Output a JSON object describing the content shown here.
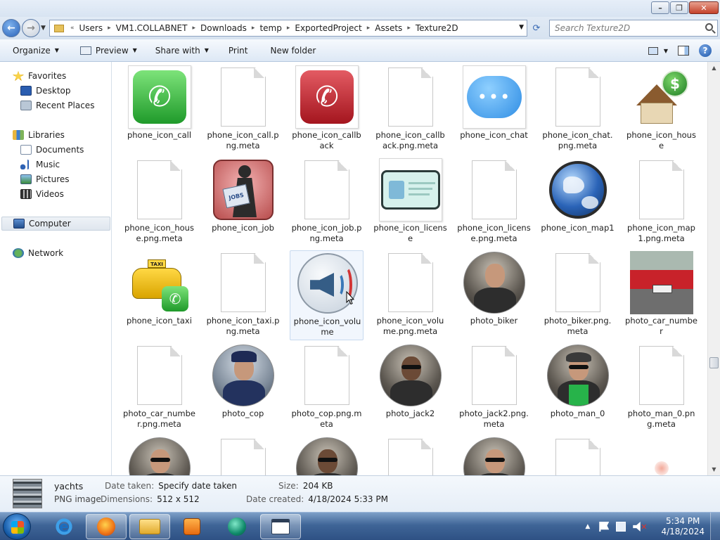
{
  "window": {
    "buttons": {
      "minimize": "–",
      "maximize": "❐",
      "close": "✕"
    }
  },
  "address": {
    "prefix": "«",
    "crumbs": [
      "Users",
      "VM1.COLLABNET",
      "Downloads",
      "temp",
      "ExportedProject",
      "Assets",
      "Texture2D"
    ],
    "search_placeholder": "Search Texture2D"
  },
  "toolbar": {
    "organize": "Organize",
    "preview": "Preview",
    "share_with": "Share with",
    "print": "Print",
    "new_folder": "New folder",
    "help": "?"
  },
  "nav": {
    "favorites": "Favorites",
    "desktop": "Desktop",
    "recent_places": "Recent Places",
    "libraries": "Libraries",
    "documents": "Documents",
    "music": "Music",
    "pictures": "Pictures",
    "videos": "Videos",
    "computer": "Computer",
    "network": "Network"
  },
  "files": [
    {
      "name": "phone_icon_call",
      "kind": "call"
    },
    {
      "name": "phone_icon_call.png.meta",
      "kind": "blank"
    },
    {
      "name": "phone_icon_callback",
      "kind": "callback"
    },
    {
      "name": "phone_icon_callback.png.meta",
      "kind": "blank"
    },
    {
      "name": "phone_icon_chat",
      "kind": "chat"
    },
    {
      "name": "phone_icon_chat.png.meta",
      "kind": "blank"
    },
    {
      "name": "phone_icon_house",
      "kind": "house"
    },
    {
      "name": "phone_icon_house.png.meta",
      "kind": "blank"
    },
    {
      "name": "phone_icon_job",
      "kind": "job"
    },
    {
      "name": "phone_icon_job.png.meta",
      "kind": "blank"
    },
    {
      "name": "phone_icon_license",
      "kind": "license"
    },
    {
      "name": "phone_icon_license.png.meta",
      "kind": "blank"
    },
    {
      "name": "phone_icon_map1",
      "kind": "globe"
    },
    {
      "name": "phone_icon_map1.png.meta",
      "kind": "blank"
    },
    {
      "name": "phone_icon_taxi",
      "kind": "taxi"
    },
    {
      "name": "phone_icon_taxi.png.meta",
      "kind": "blank"
    },
    {
      "name": "phone_icon_volume",
      "kind": "volume"
    },
    {
      "name": "phone_icon_volume.png.meta",
      "kind": "blank"
    },
    {
      "name": "photo_biker",
      "kind": "biker"
    },
    {
      "name": "photo_biker.png.meta",
      "kind": "blank"
    },
    {
      "name": "photo_car_number",
      "kind": "car"
    },
    {
      "name": "photo_car_number.png.meta",
      "kind": "blank"
    },
    {
      "name": "photo_cop",
      "kind": "cop"
    },
    {
      "name": "photo_cop.png.meta",
      "kind": "blank"
    },
    {
      "name": "photo_jack2",
      "kind": "jack"
    },
    {
      "name": "photo_jack2.png.meta",
      "kind": "blank"
    },
    {
      "name": "photo_man_0",
      "kind": "man0"
    },
    {
      "name": "photo_man_0.png.meta",
      "kind": "blank"
    },
    {
      "name": "",
      "kind": "bald"
    },
    {
      "name": "",
      "kind": "blank"
    },
    {
      "name": "",
      "kind": "jack"
    },
    {
      "name": "",
      "kind": "blank"
    },
    {
      "name": "",
      "kind": "bald"
    },
    {
      "name": "",
      "kind": "blank"
    },
    {
      "name": "",
      "kind": "dot"
    }
  ],
  "selected_index": 16,
  "details": {
    "name": "yachts",
    "type": "PNG image",
    "date_taken_label": "Date taken:",
    "date_taken_value": "Specify date taken",
    "dimensions_label": "Dimensions:",
    "dimensions_value": "512 x 512",
    "size_label": "Size:",
    "size_value": "204 KB",
    "date_created_label": "Date created:",
    "date_created_value": "4/18/2024 5:33 PM"
  },
  "taskbar": {
    "time": "5:34 PM",
    "date": "4/18/2024",
    "tray_up": "▲",
    "mute": "✕"
  }
}
